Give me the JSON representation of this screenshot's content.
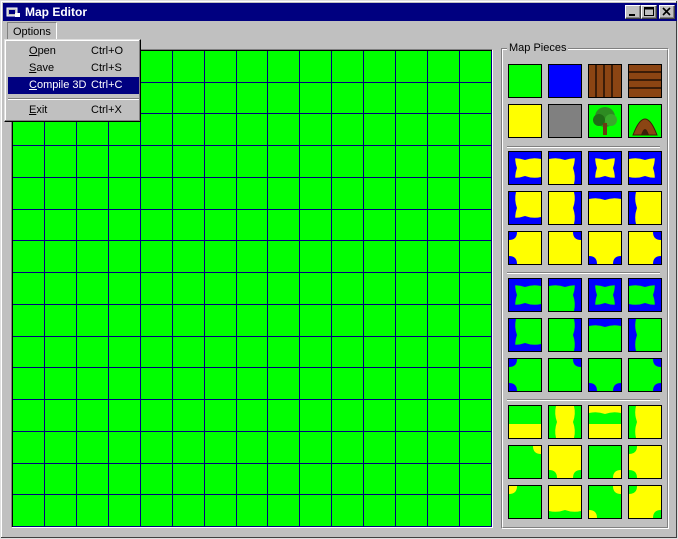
{
  "window": {
    "title": "Map Editor"
  },
  "menu": {
    "options_label": "Options"
  },
  "dropdown": {
    "items": [
      {
        "label": "Open",
        "shortcut": "Ctrl+O"
      },
      {
        "label": "Save",
        "shortcut": "Ctrl+S"
      },
      {
        "label": "Compile 3D",
        "shortcut": "Ctrl+C"
      },
      {
        "label": "Exit",
        "shortcut": "Ctrl+X"
      }
    ]
  },
  "map": {
    "columns": 15,
    "rows": 15,
    "fill_color": "#00ff00",
    "grid_color": "#000080"
  },
  "pieces_panel": {
    "label": "Map Pieces",
    "colors": {
      "grass": "#00ff00",
      "water": "#0000ff",
      "sand": "#ffff00",
      "stone": "#808080",
      "wood": "#8b4513"
    }
  }
}
